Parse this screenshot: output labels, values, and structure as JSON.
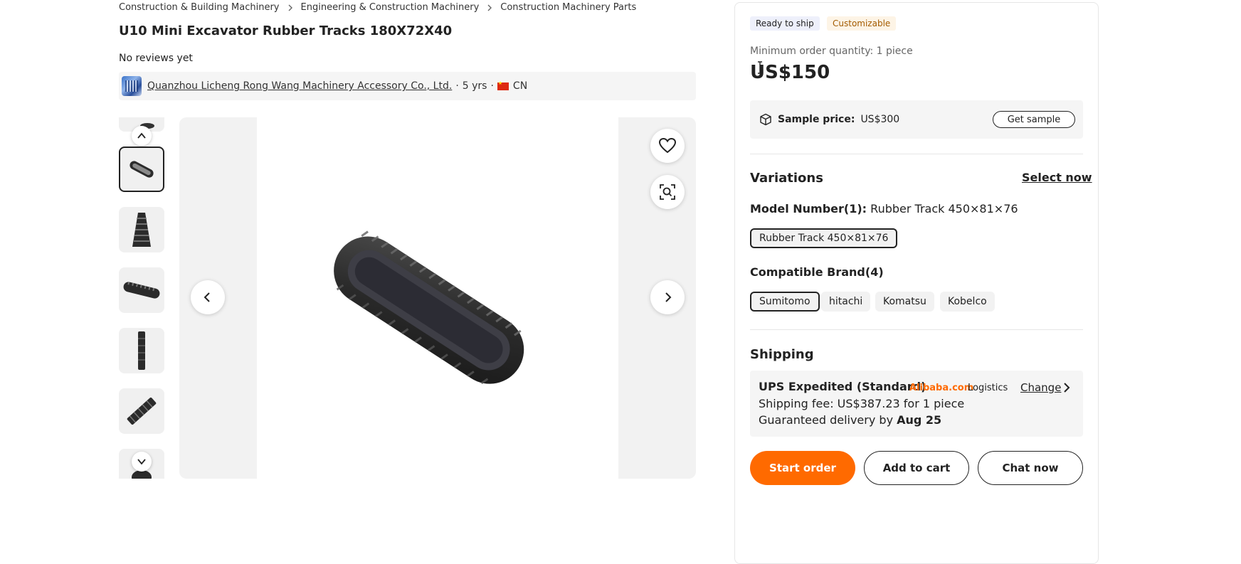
{
  "breadcrumb": [
    "Construction & Building Machinery",
    "Engineering & Construction Machinery",
    "Construction Machinery Parts"
  ],
  "product": {
    "title": "U10 Mini Excavator Rubber Tracks 180X72X40",
    "reviews": "No reviews yet"
  },
  "supplier": {
    "name": "Quanzhou Licheng Rong Wang Machinery Accessory Co., Ltd.",
    "years": "5 yrs",
    "country": "CN"
  },
  "gallery": {
    "thumbnail_count_visible": 6,
    "active_thumbnail": 1
  },
  "badges": {
    "ready": "Ready to ship",
    "custom": "Customizable"
  },
  "pricing": {
    "moq": "Minimum order quantity: 1 piece",
    "price": "US$150",
    "sample_label": "Sample price:",
    "sample_value": "US$300",
    "get_sample": "Get sample"
  },
  "variations": {
    "title": "Variations",
    "select_now": "Select now",
    "model_label": "Model Number(1):",
    "model_value": "Rubber Track 450×81×76",
    "model_options": [
      "Rubber Track 450×81×76"
    ],
    "brand_label": "Compatible Brand(4)",
    "brand_options": [
      "Sumitomo",
      "hitachi",
      "Komatsu",
      "Kobelco"
    ]
  },
  "shipping": {
    "title": "Shipping",
    "method": "UPS Expedited (Standard)",
    "provider_brand": "Alibaba.com",
    "provider_suffix": "Logistics",
    "change": "Change",
    "fee": "Shipping fee: US$387.23 for 1 piece",
    "delivery_prefix": "Guaranteed delivery by",
    "delivery_date": "Aug 25"
  },
  "actions": {
    "start": "Start order",
    "cart": "Add to cart",
    "chat": "Chat now"
  },
  "colors": {
    "accent": "#ff6a00",
    "text": "#222222",
    "muted": "#666666",
    "panel_bg": "#f5f5f5"
  }
}
